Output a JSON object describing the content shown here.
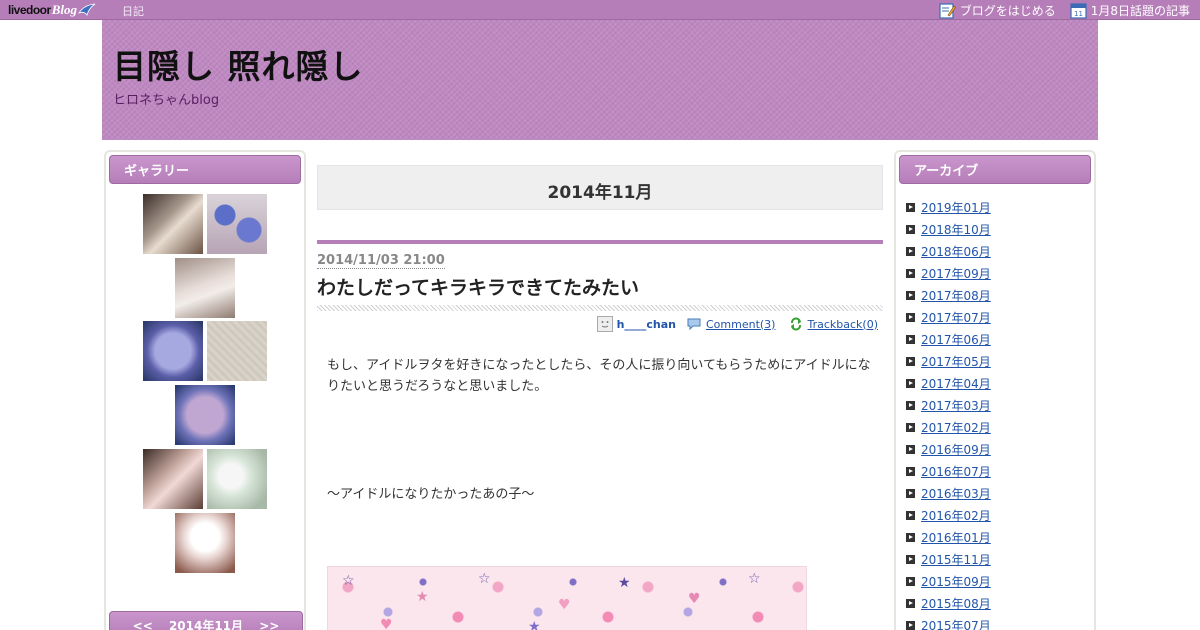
{
  "topbar": {
    "logo_text": "livedoor",
    "logo_blog": "Blog",
    "nav_label": "日記",
    "start_blog_label": "ブログをはじめる",
    "trending_label": "1月8日話題の記事",
    "calendar_icon_number": "11"
  },
  "header": {
    "title": "目隠し 照れ隠し",
    "description": "ヒロネちゃんblog"
  },
  "gallery": {
    "heading": "ギャラリー"
  },
  "calendar": {
    "prev": "<<",
    "label": "2014年11月",
    "next": ">>"
  },
  "archive": {
    "heading": "アーカイブ",
    "items": [
      "2019年01月",
      "2018年10月",
      "2018年06月",
      "2017年09月",
      "2017年08月",
      "2017年07月",
      "2017年06月",
      "2017年05月",
      "2017年04月",
      "2017年03月",
      "2017年02月",
      "2016年09月",
      "2016年07月",
      "2016年03月",
      "2016年02月",
      "2016年01月",
      "2015年11月",
      "2015年09月",
      "2015年08月",
      "2015年07月"
    ]
  },
  "main": {
    "month_heading": "2014年11月",
    "post": {
      "date": "2014/11/03 21:00",
      "title": "わたしだってキラキラできてたみたい",
      "author": "h____chan",
      "comment_link": "Comment(3)",
      "trackback_link": "Trackback(0)",
      "paragraph1": "もし、アイドルヲタを好きになったとしたら、その人に振り向いてもらうためにアイドルになりたいと思うだろうなと思いました。",
      "paragraph2": "〜アイドルになりたかったあの子〜"
    }
  },
  "colors": {
    "accent": "#b67eb9",
    "link": "#2255aa"
  }
}
